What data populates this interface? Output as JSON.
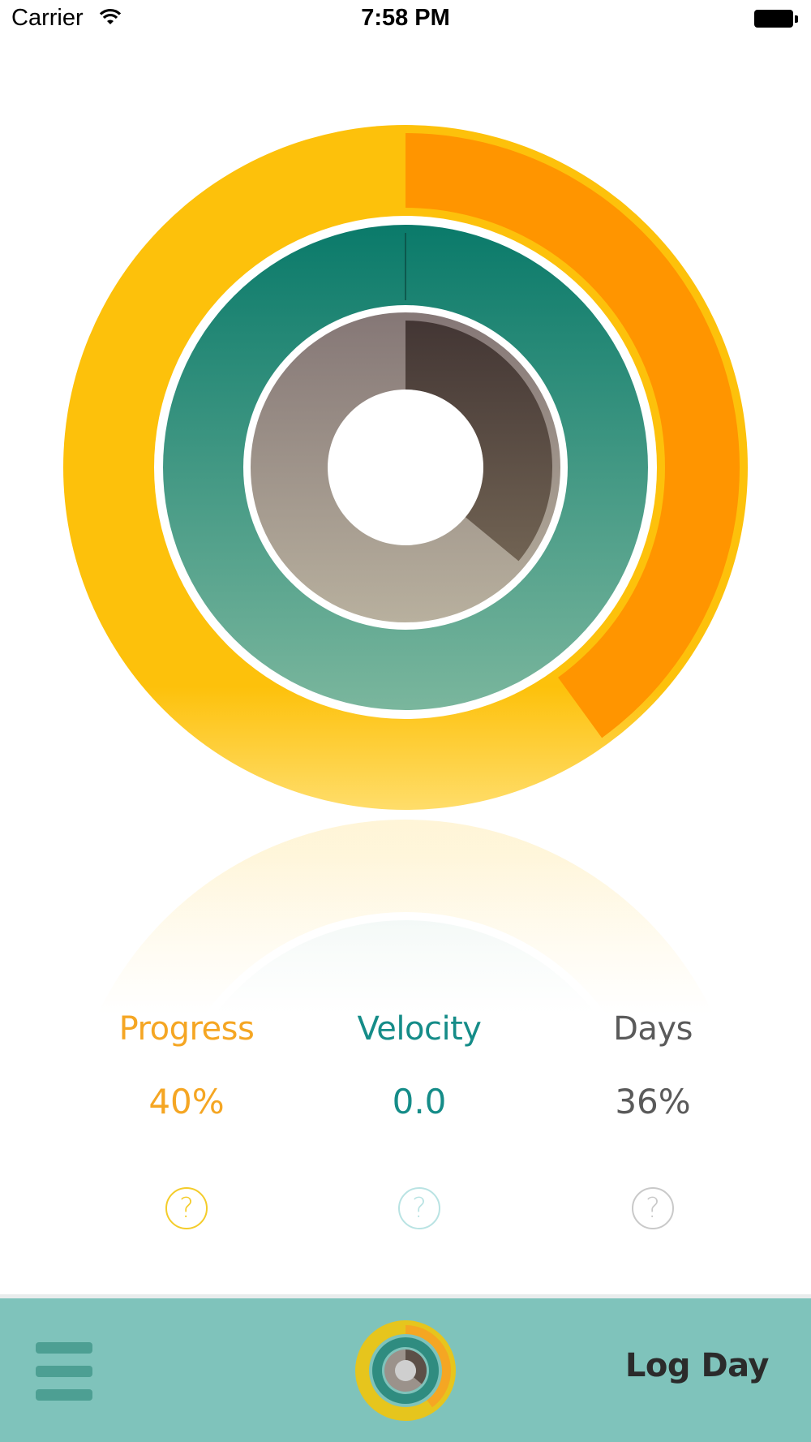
{
  "status_bar": {
    "carrier": "Carrier",
    "time": "7:58 PM"
  },
  "rings": {
    "outer_progress_fraction": 0.4,
    "middle_velocity_fraction": 0.0,
    "inner_days_fraction": 0.36,
    "colors": {
      "outer_track": "#fdc10b",
      "outer_fill": "#ff9500",
      "middle_track_top": "#0a7a6a",
      "middle_track_bottom": "#7ab69d",
      "inner_track_top": "#857776",
      "inner_track_bottom": "#b8b09e",
      "inner_fill_top": "#433634",
      "inner_fill_bottom": "#6e6051"
    }
  },
  "stats": [
    {
      "label": "Progress",
      "value": "40%",
      "color": "#f5a623",
      "help": "?",
      "help_color": "#f4cc2a"
    },
    {
      "label": "Velocity",
      "value": "0.0",
      "color": "#158c88",
      "help": "?",
      "help_color": "#b9e3e3"
    },
    {
      "label": "Days",
      "value": "36%",
      "color": "#5a5a5a",
      "help": "?",
      "help_color": "#c9c9c9"
    }
  ],
  "bottom_bar": {
    "log_day_label": "Log Day",
    "menu_icon": "hamburger-menu-icon",
    "center_icon": "progress-rings-icon"
  }
}
